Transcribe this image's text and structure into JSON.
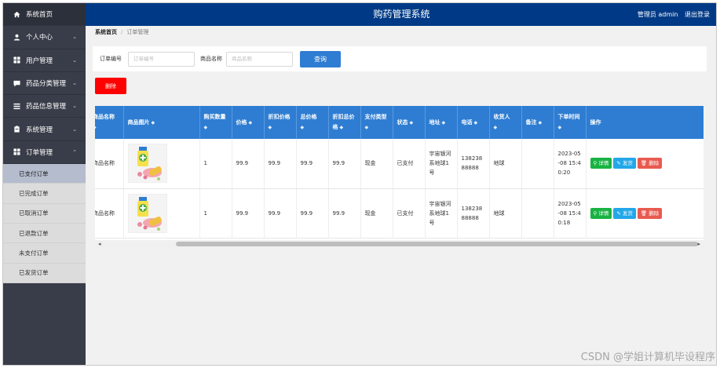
{
  "header": {
    "title": "购药管理系统",
    "user_label": "管理员 admin",
    "logout_label": "退出登录"
  },
  "sidebar": {
    "items": [
      {
        "label": "系统首页",
        "icon": "home-icon"
      },
      {
        "label": "个人中心",
        "icon": "user-icon"
      },
      {
        "label": "用户管理",
        "icon": "grid-icon"
      },
      {
        "label": "药品分类管理",
        "icon": "comment-icon"
      },
      {
        "label": "药品信息管理",
        "icon": "list-icon"
      },
      {
        "label": "系统管理",
        "icon": "clipboard-icon"
      },
      {
        "label": "订单管理",
        "icon": "grid-icon"
      }
    ],
    "order_submenu": [
      "已支付订单",
      "已完成订单",
      "已取消订单",
      "已退款订单",
      "未支付订单",
      "已发货订单"
    ],
    "active_sub": "已支付订单"
  },
  "breadcrumb": {
    "home": "系统首页",
    "separator": "/",
    "current": "订单管理"
  },
  "search": {
    "order_no_label": "订单编号",
    "order_no_placeholder": "订单编号",
    "order_no_value": "",
    "drug_name_label": "商品名称",
    "drug_name_placeholder": "商品名称",
    "drug_name_value": "",
    "query_button": "查询"
  },
  "delete_button": "删除",
  "table": {
    "sort_glyph": "◆",
    "columns": [
      "商品名称",
      "商品图片",
      "购买数量",
      "价格",
      "折扣价格",
      "总价格",
      "折扣总价格",
      "支付类型",
      "状态",
      "地址",
      "电话",
      "收货人",
      "备注",
      "下单时间",
      "操作"
    ],
    "rows": [
      {
        "name": "商品名称",
        "qty": "1",
        "price": "99.9",
        "discount_price": "99.9",
        "total": "99.9",
        "discount_total": "99.9",
        "pay_type": "现金",
        "status": "已支付",
        "address": "宇宙银河系地球1号",
        "phone": "13823888888",
        "receiver": "地球",
        "remark": "",
        "order_time": "2023-05-08 15:40:20"
      },
      {
        "name": "商品名称",
        "qty": "1",
        "price": "99.9",
        "discount_price": "99.9",
        "total": "99.9",
        "discount_total": "99.9",
        "pay_type": "现金",
        "status": "已支付",
        "address": "宇宙银河系地球1号",
        "phone": "13823888888",
        "receiver": "地球",
        "remark": "",
        "order_time": "2023-05-08 15:40:18"
      }
    ],
    "actions": {
      "detail": "详情",
      "ship": "发货",
      "delete": "删除"
    }
  },
  "watermark": "CSDN @学姐计算机毕设程序",
  "colors": {
    "header_bg": "#003a86",
    "sidebar_bg": "#393d49",
    "primary": "#2e7dd2",
    "delete_red": "#ff0000",
    "detail_green": "#19b343",
    "ship_blue": "#22a7e9",
    "row_delete": "#e85a4f"
  }
}
